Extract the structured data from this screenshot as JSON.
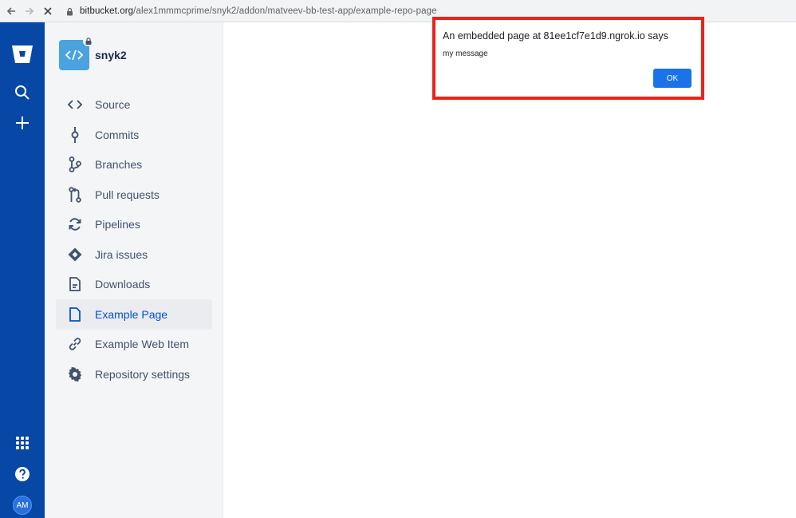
{
  "browser": {
    "url_host": "bitbucket.org",
    "url_path": "/alex1mmmcprime/snyk2/addon/matveev-bb-test-app/example-repo-page"
  },
  "global_nav": {
    "avatar_initials": "AM"
  },
  "repo": {
    "name": "snyk2"
  },
  "sidebar": {
    "items": [
      {
        "label": "Source",
        "icon": "code-icon"
      },
      {
        "label": "Commits",
        "icon": "commit-icon"
      },
      {
        "label": "Branches",
        "icon": "branch-icon"
      },
      {
        "label": "Pull requests",
        "icon": "pull-request-icon"
      },
      {
        "label": "Pipelines",
        "icon": "pipelines-icon"
      },
      {
        "label": "Jira issues",
        "icon": "jira-icon"
      },
      {
        "label": "Downloads",
        "icon": "downloads-icon"
      },
      {
        "label": "Example Page",
        "icon": "page-icon",
        "active": true
      },
      {
        "label": "Example Web Item",
        "icon": "link-icon"
      },
      {
        "label": "Repository settings",
        "icon": "gear-icon"
      }
    ]
  },
  "dialog": {
    "title": "An embedded page at 81ee1cf7e1d9.ngrok.io says",
    "message": "my message",
    "ok_label": "OK"
  },
  "colors": {
    "global_nav": "#0747a6",
    "active_text": "#0052cc",
    "highlight_border": "#e8241b",
    "ok_button": "#1a73e8"
  }
}
